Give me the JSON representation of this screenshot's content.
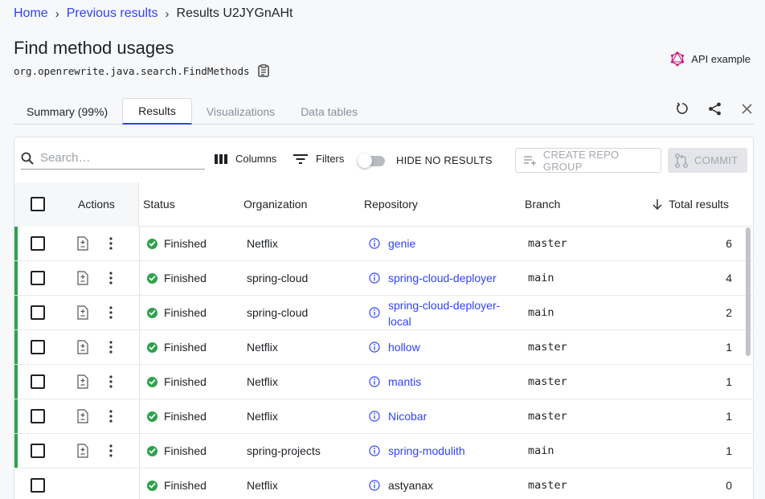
{
  "breadcrumb": {
    "home": "Home",
    "previous": "Previous results",
    "current": "Results U2JYGnAHt"
  },
  "page": {
    "title": "Find method usages",
    "recipe_id": "org.openrewrite.java.search.FindMethods",
    "api_example": "API example"
  },
  "tabs": [
    {
      "label": "Summary (99%)"
    },
    {
      "label": "Results"
    },
    {
      "label": "Visualizations"
    },
    {
      "label": "Data tables"
    }
  ],
  "toolbar": {
    "search_placeholder": "Search…",
    "columns_label": "Columns",
    "filters_label": "Filters",
    "hide_no_results_label": "HIDE NO RESULTS",
    "hide_no_results_on": false,
    "create_repo_group_label": "CREATE REPO GROUP",
    "commit_label": "COMMIT"
  },
  "table": {
    "headers": {
      "actions": "Actions",
      "status": "Status",
      "organization": "Organization",
      "repository": "Repository",
      "branch": "Branch",
      "total_results": "Total results"
    },
    "rows": [
      {
        "status": "Finished",
        "organization": "Netflix",
        "repository": "genie",
        "branch": "master",
        "total": "6"
      },
      {
        "status": "Finished",
        "organization": "spring-cloud",
        "repository": "spring-cloud-deployer",
        "branch": "main",
        "total": "4"
      },
      {
        "status": "Finished",
        "organization": "spring-cloud",
        "repository": "spring-cloud-deployer-local",
        "branch": "main",
        "total": "2"
      },
      {
        "status": "Finished",
        "organization": "Netflix",
        "repository": "hollow",
        "branch": "master",
        "total": "1"
      },
      {
        "status": "Finished",
        "organization": "Netflix",
        "repository": "mantis",
        "branch": "master",
        "total": "1"
      },
      {
        "status": "Finished",
        "organization": "Netflix",
        "repository": "Nicobar",
        "branch": "master",
        "total": "1"
      },
      {
        "status": "Finished",
        "organization": "spring-projects",
        "repository": "spring-modulith",
        "branch": "main",
        "total": "1"
      },
      {
        "status": "Finished",
        "organization": "Netflix",
        "repository": "astyanax",
        "branch": "master",
        "total": "0"
      }
    ]
  },
  "colors": {
    "accent": "#2f42ff",
    "success": "#2ea14c",
    "api_icon": "#d0187a"
  }
}
